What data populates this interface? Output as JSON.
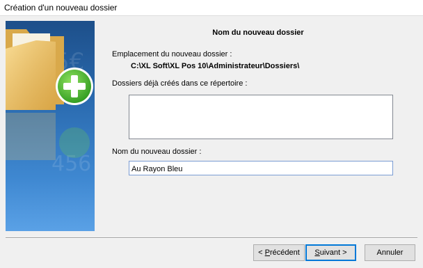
{
  "window": {
    "title": "Création d'un nouveau dossier"
  },
  "banner": {
    "icon": "folder-add-icon",
    "accent": "#2b6cb1"
  },
  "form": {
    "heading": "Nom du nouveau dossier",
    "location_label": "Emplacement du nouveau dossier :",
    "location_value": "C:\\XL Soft\\XL Pos 10\\Administrateur\\Dossiers\\",
    "existing_label": "Dossiers déjà créés dans ce répertoire :",
    "existing_items": [],
    "name_label": "Nom du nouveau dossier :",
    "name_value": "Au Rayon Bleu"
  },
  "buttons": {
    "previous": {
      "prefix": "< ",
      "mnemonic": "P",
      "rest": "récédent"
    },
    "next": {
      "mnemonic": "S",
      "rest": "uivant >"
    },
    "cancel": "Annuler"
  }
}
